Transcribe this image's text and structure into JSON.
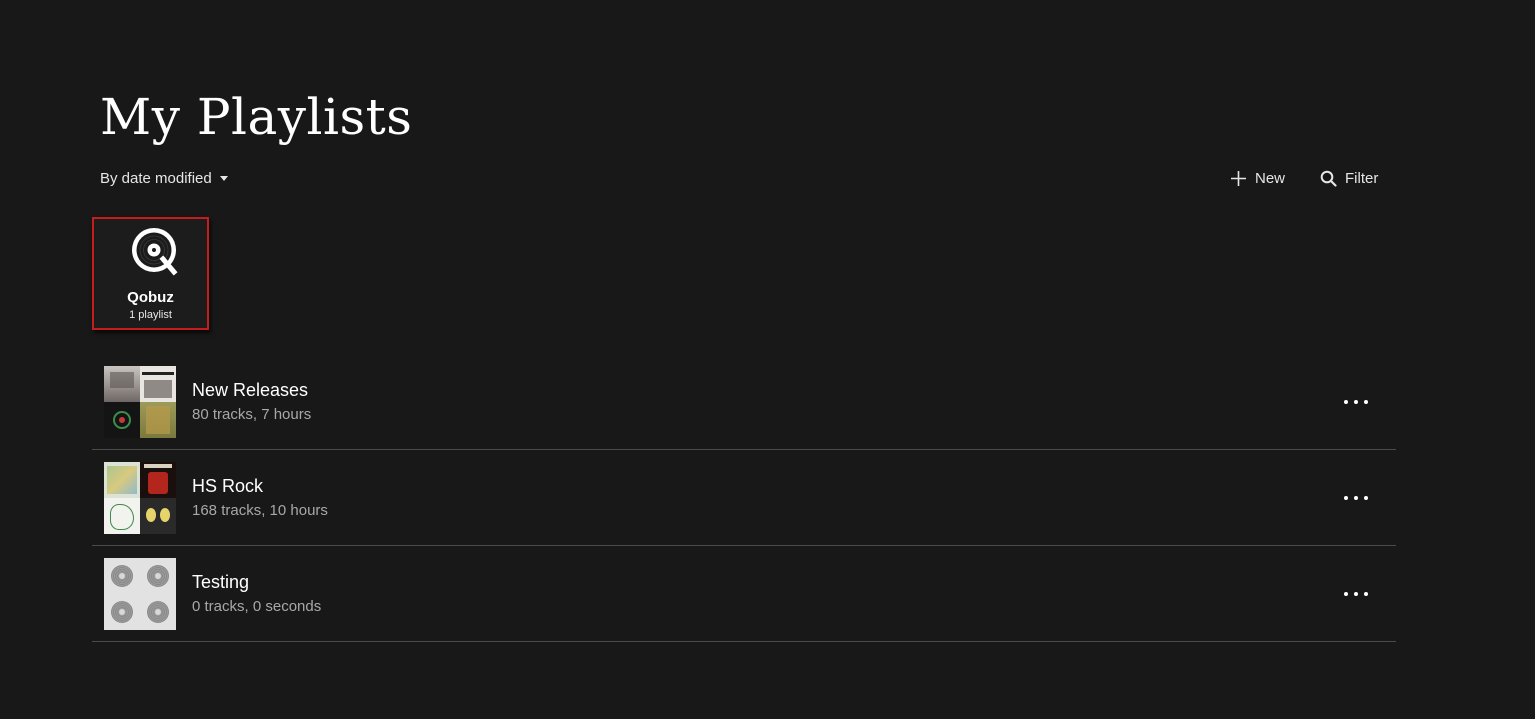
{
  "page": {
    "title": "My Playlists"
  },
  "sort": {
    "label": "By date modified"
  },
  "toolbar": {
    "new_label": "New",
    "filter_label": "Filter"
  },
  "service_tile": {
    "name": "Qobuz",
    "subtitle": "1 playlist",
    "icon": "qobuz-logo",
    "selected_border_color": "#c41d1d"
  },
  "playlists": [
    {
      "title": "New Releases",
      "subtitle": "80 tracks, 7 hours"
    },
    {
      "title": "HS Rock",
      "subtitle": "168 tracks, 10 hours"
    },
    {
      "title": "Testing",
      "subtitle": "0 tracks, 0 seconds"
    }
  ],
  "colors": {
    "background": "#181818",
    "divider": "#4a4a4a",
    "secondary_text": "#a8a8a8"
  }
}
